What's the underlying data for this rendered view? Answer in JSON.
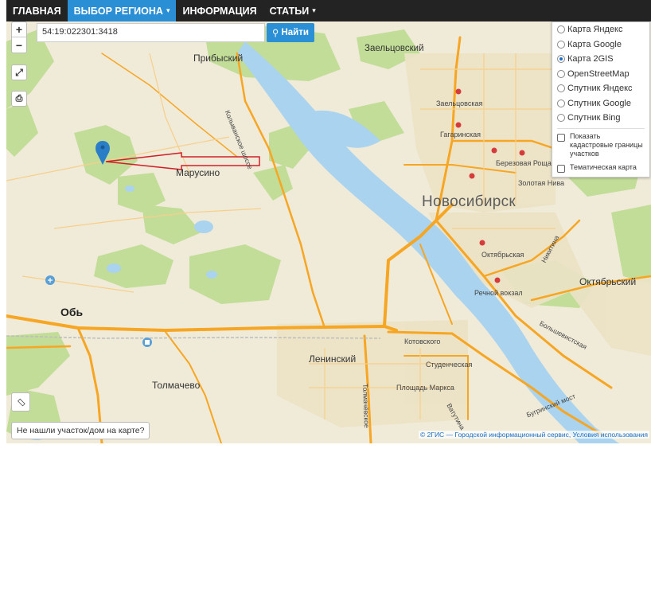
{
  "nav": {
    "home": "ГЛАВНАЯ",
    "region": "ВЫБОР РЕГИОНА",
    "info": "ИНФОРМАЦИЯ",
    "articles": "СТАТЬИ"
  },
  "search": {
    "value": "54:19:022301:3418",
    "button": "Найти"
  },
  "controls": {
    "zoom_in": "+",
    "zoom_out": "−"
  },
  "layers": {
    "options": [
      "Карта Яндекс",
      "Карта Google",
      "Карта 2GIS",
      "OpenStreetMap",
      "Спутник Яндекс",
      "Спутник Google",
      "Спутник Bing"
    ],
    "selected": "Карта 2GIS",
    "cadastral": "Показать кадастровые границы участков",
    "thematic": "Тематическая карта"
  },
  "labels": {
    "zeltsovsky": "Заельцовский",
    "pribysky": "Прибыский",
    "marusino": "Марусино",
    "novosibirsk": "Новосибирск",
    "ob": "Обь",
    "tolmachevo": "Толмачево",
    "leninsky": "Ленинский",
    "oktyabrsky": "Октябрьский",
    "zaeltsovskaya": "Заельцовская",
    "gagarinskaya": "Гагаринская",
    "berezovaya": "Березовая Роща",
    "zolotaya": "Золотая Нива",
    "oktyabrskaya": "Октябрьская",
    "rechnoy": "Речной вокзал",
    "kotovskogo": "Котовского",
    "studencheskaya": "Студенческая",
    "ploshchad": "Площадь Маркса",
    "kolyvan": "Колыванское шоссе",
    "tolmachevskoe": "Толмачёвское",
    "nikitina": "Никитина",
    "bolshevistskaya": "Большевистская",
    "bugrinsky": "Бугринский мост",
    "vatutina": "Ватутина"
  },
  "not_found": "Не нашли участок/дом на карте?",
  "attribution": "© 2ГИС — Городской информационный сервис, Условия использования",
  "colors": {
    "nav_bg": "#232323",
    "accent": "#2b8fd6",
    "water": "#a9d3ee",
    "green": "#b7d98b",
    "road": "#f6a623"
  }
}
